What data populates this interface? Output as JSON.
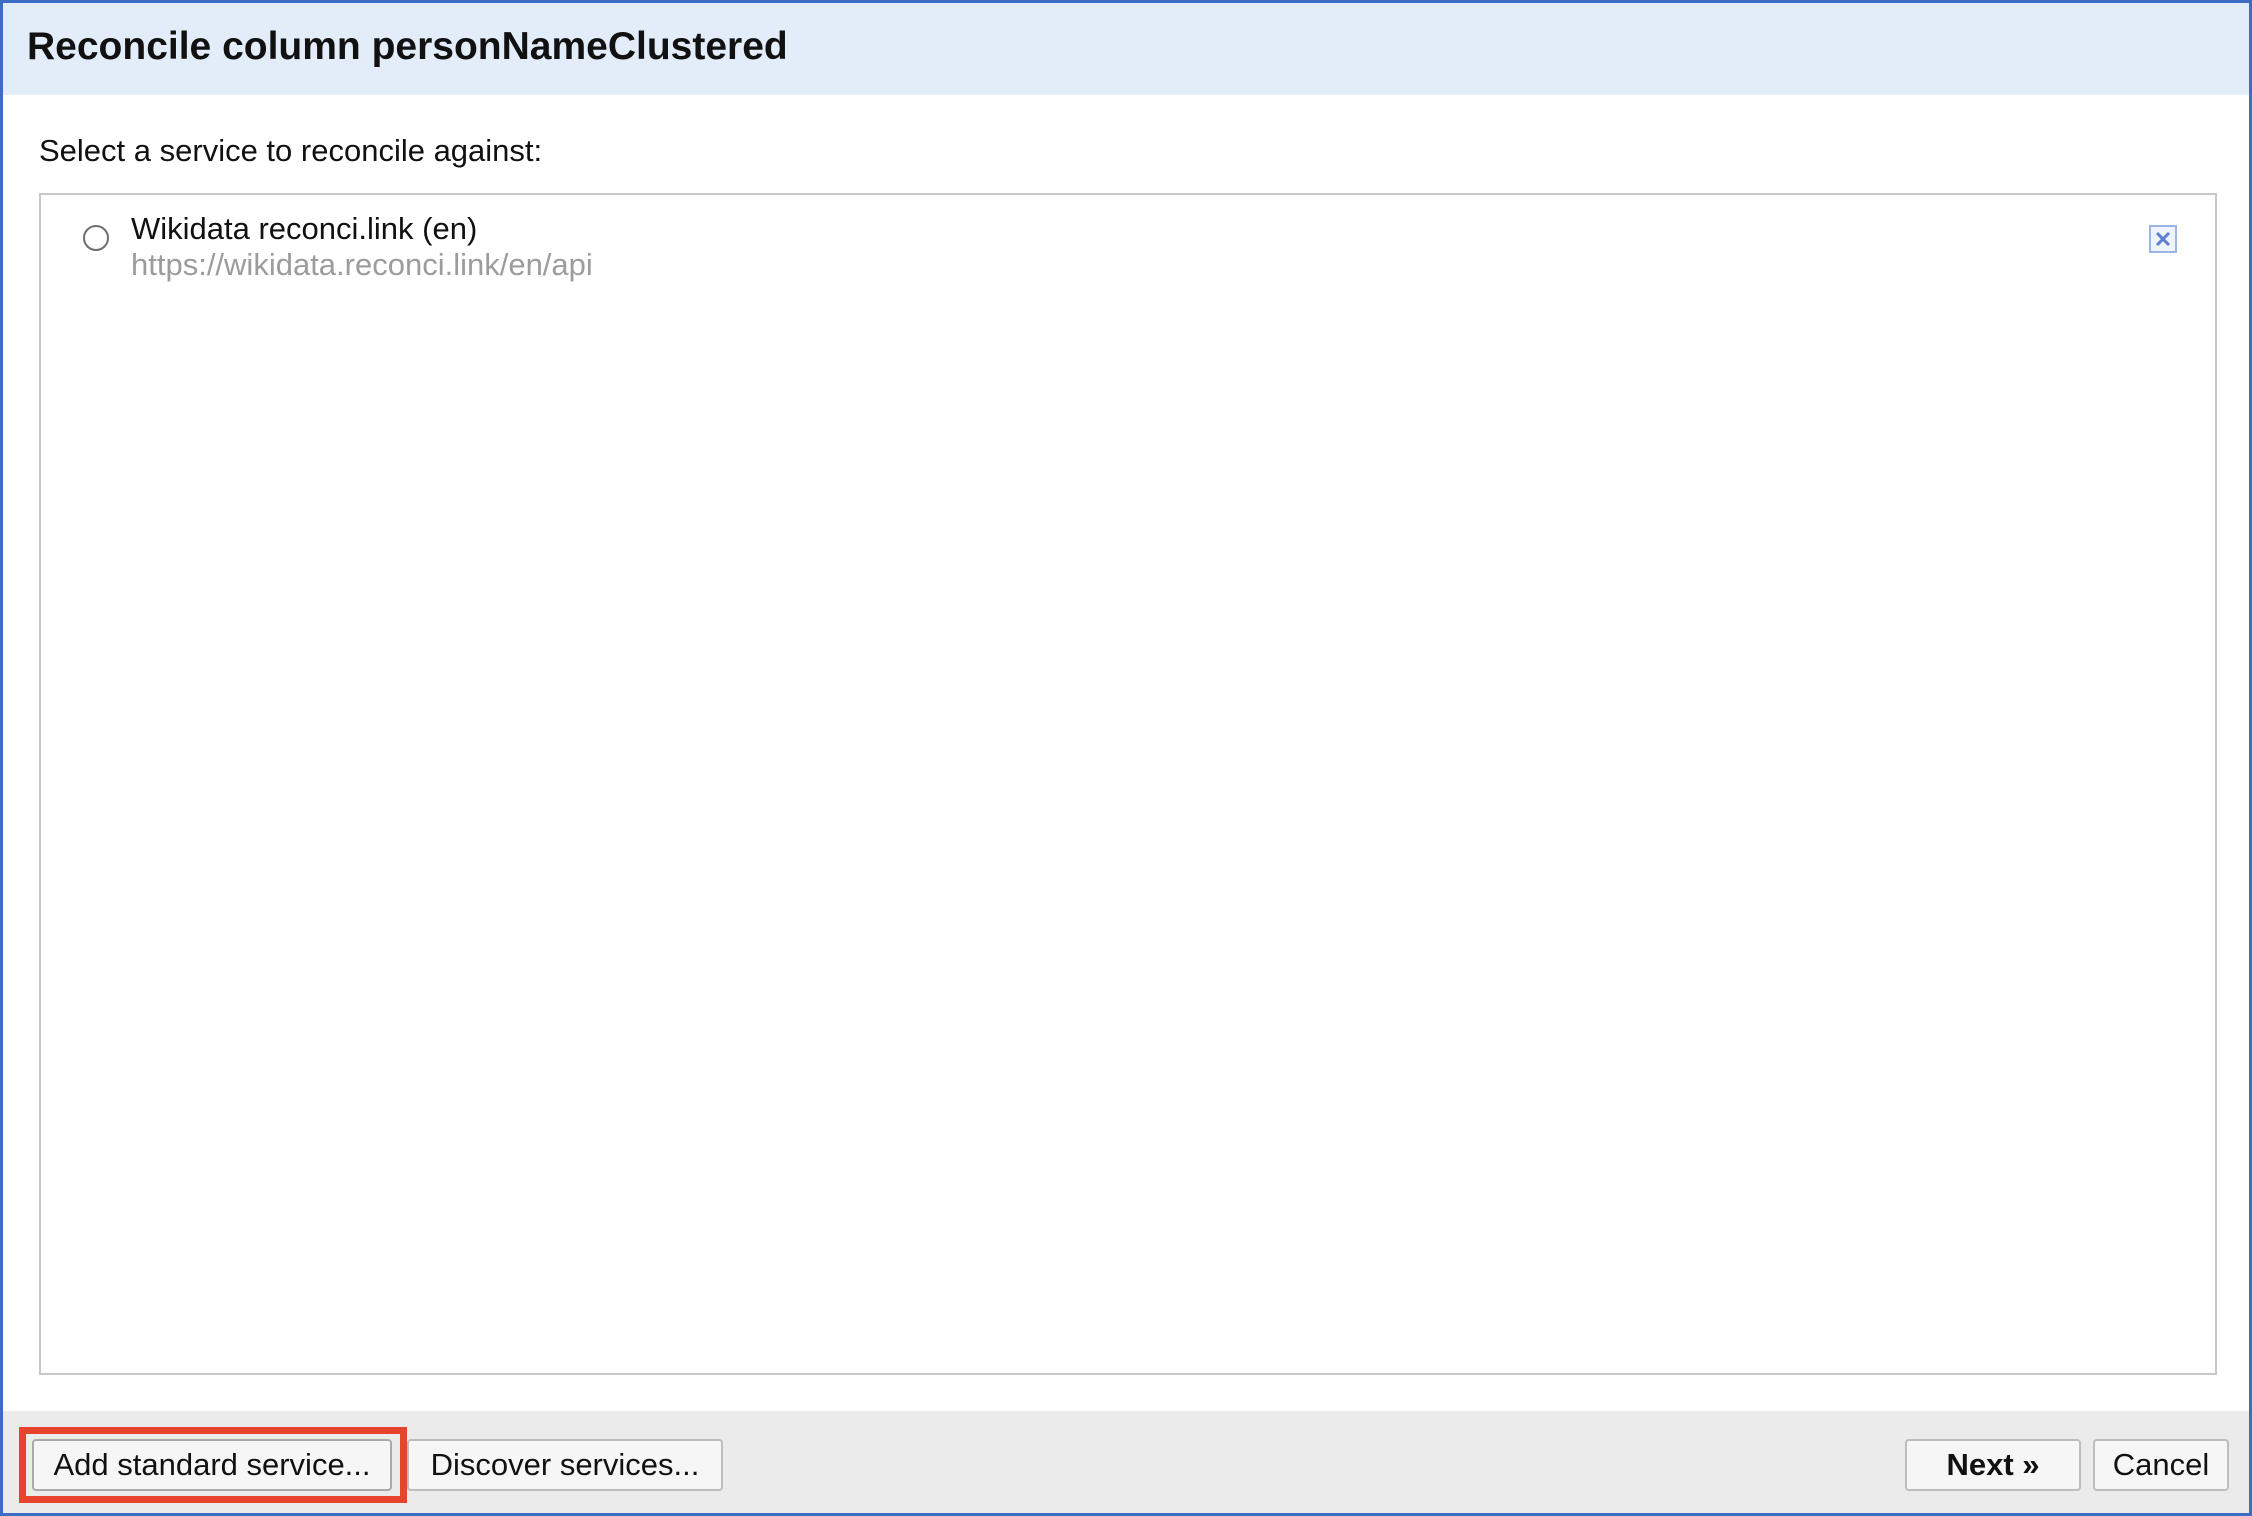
{
  "dialog": {
    "title": "Reconcile column personNameClustered",
    "prompt": "Select a service to reconcile against:"
  },
  "services": [
    {
      "name": "Wikidata reconci.link (en)",
      "url": "https://wikidata.reconci.link/en/api",
      "selected": false
    }
  ],
  "footer": {
    "add_label": "Add standard service...",
    "discover_label": "Discover services...",
    "next_label": "Next »",
    "cancel_label": "Cancel"
  },
  "colors": {
    "header_bg": "#e3edfa",
    "border_accent": "#3d6cc4",
    "highlight": "#e8442b"
  },
  "icons": {
    "remove": "close-icon"
  }
}
